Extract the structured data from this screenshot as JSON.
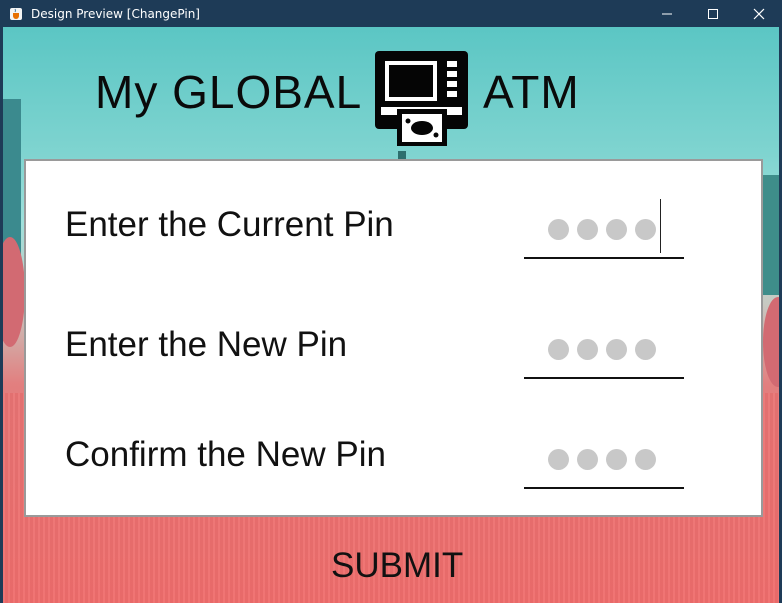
{
  "window": {
    "title": "Design Preview [ChangePin]",
    "app_icon": "java-cup-icon",
    "controls": [
      "minimize-icon",
      "maximize-icon",
      "close-icon"
    ]
  },
  "brand": {
    "left_text": "My GLOBAL",
    "right_text": "ATM",
    "logo_icon": "atm-machine-icon"
  },
  "form": {
    "rows": [
      {
        "label": "Enter the Current Pin",
        "pin_dots": 4,
        "focused": true
      },
      {
        "label": "Enter the New Pin",
        "pin_dots": 4,
        "focused": false
      },
      {
        "label": "Confirm the New Pin",
        "pin_dots": 4,
        "focused": false
      }
    ],
    "submit_label": "SUBMIT"
  },
  "colors": {
    "titlebar": "#1e3b57",
    "panel": "#ffffff",
    "text": "#111111",
    "pin_dot": "#c8c8c8"
  }
}
